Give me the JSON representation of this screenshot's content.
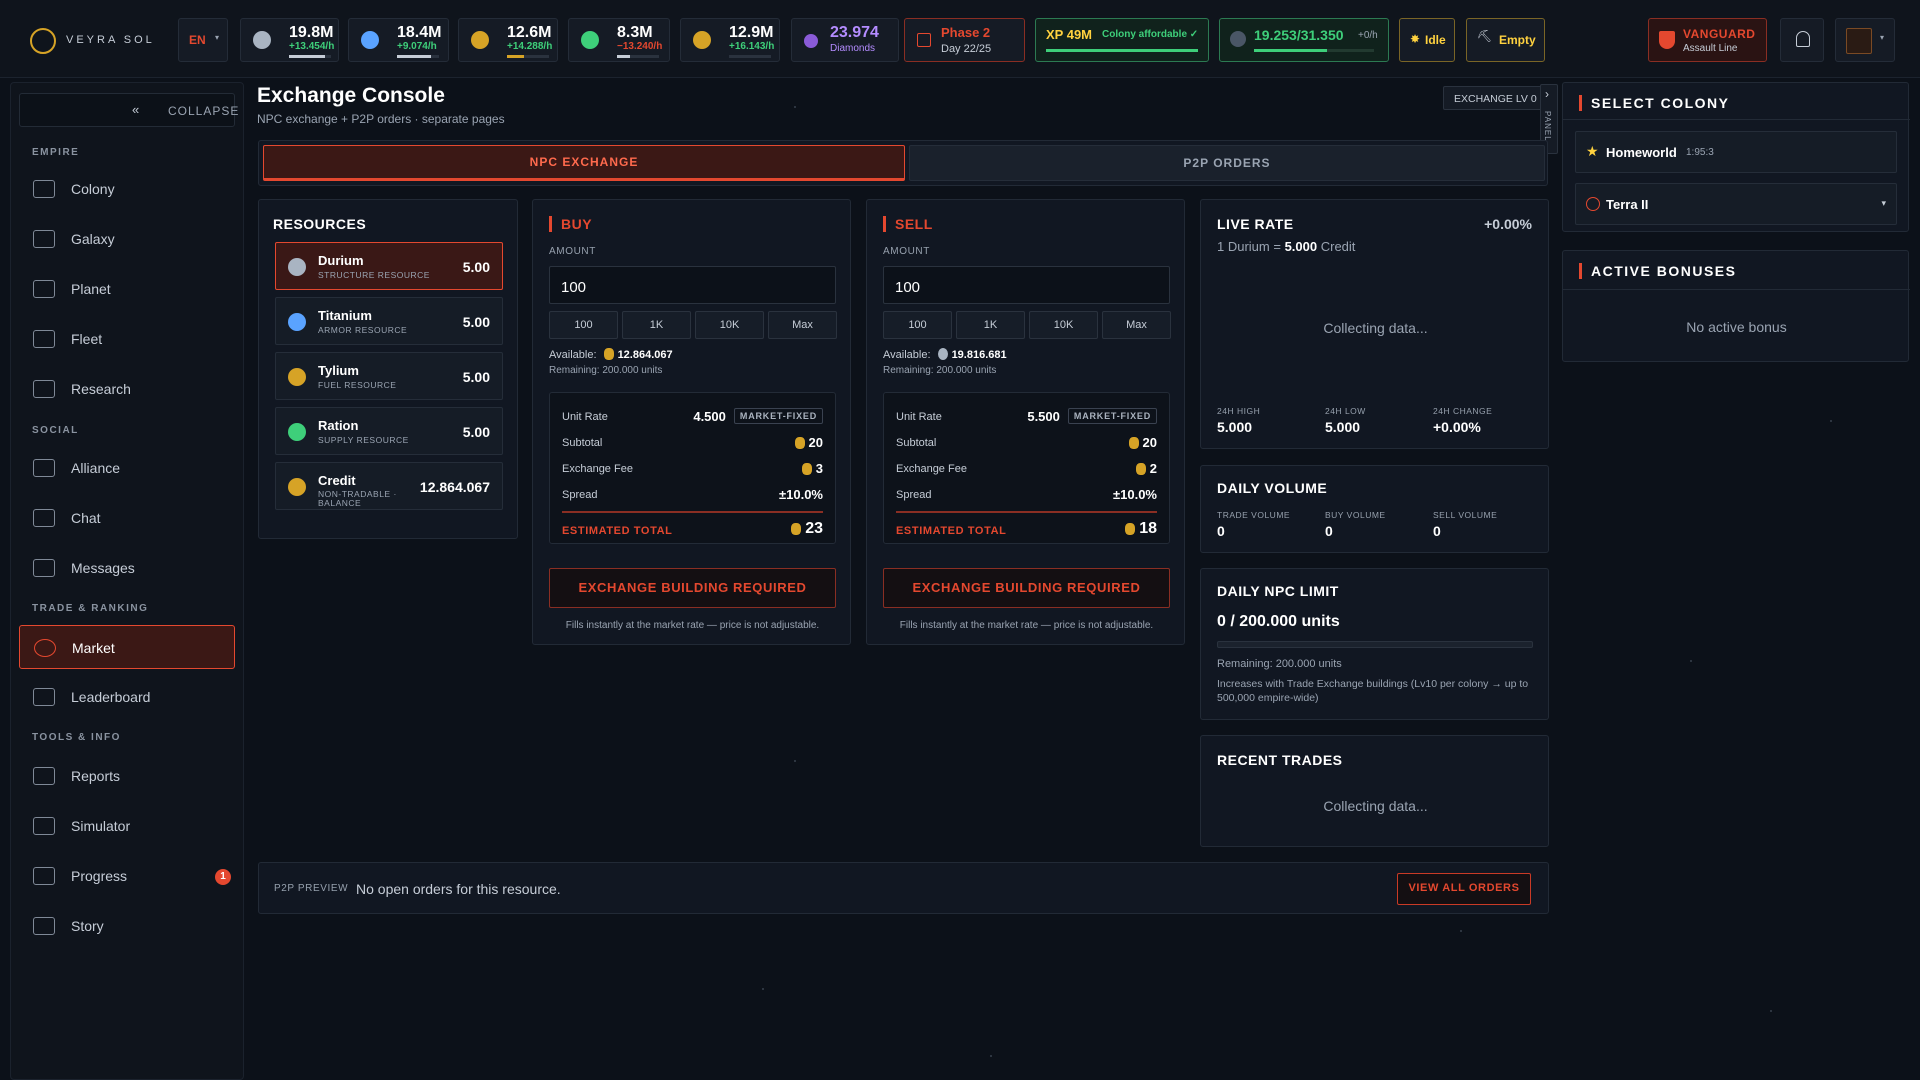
{
  "header": {
    "brand": "VEYRA SOL",
    "language": "EN",
    "resources": [
      {
        "name": "durium-icon",
        "value": "19.8M",
        "rate": "+13.454/h",
        "rate_color": "#3ecf7a",
        "bar_fill": 0.85,
        "icon_color": "#a9b4c2"
      },
      {
        "name": "titanium-icon",
        "value": "18.4M",
        "rate": "+9.074/h",
        "rate_color": "#3ecf7a",
        "bar_fill": 0.8,
        "icon_color": "#5aa3ff"
      },
      {
        "name": "tylium-icon",
        "value": "12.6M",
        "rate": "+14.288/h",
        "rate_color": "#3ecf7a",
        "bar_fill": 0.4,
        "icon_color": "#d6a326"
      },
      {
        "name": "ration-icon",
        "value": "8.3M",
        "rate": "−13.240/h",
        "rate_color": "#e4482f",
        "bar_fill": 0.3,
        "icon_color": "#3ecf7a"
      },
      {
        "name": "credit-icon",
        "value": "12.9M",
        "rate": "+16.143/h",
        "rate_color": "#3ecf7a",
        "bar_fill": 0.0,
        "icon_color": "#d6a326"
      }
    ],
    "diamonds": {
      "value": "23.974",
      "label": "Diamonds"
    },
    "phase": {
      "title": "Phase 2",
      "day": "Day 22/25"
    },
    "xp": {
      "value": "XP 49M",
      "status": "Colony affordable ✓",
      "fill": 1.0
    },
    "population": {
      "value": "19.253/31.350",
      "rate": "+0/h",
      "fill": 0.61
    },
    "idle_label": "Idle",
    "empty_label": "Empty",
    "faction": {
      "name": "VANGUARD",
      "sub": "Assault Line"
    }
  },
  "sidebar": {
    "collapse_label": "COLLAPSE",
    "sections": {
      "empire": "EMPIRE",
      "social": "SOCIAL",
      "trade": "TRADE & RANKING",
      "tools": "TOOLS & INFO"
    },
    "items": [
      "Colony",
      "Galaxy",
      "Planet",
      "Fleet",
      "Research",
      "Alliance",
      "Chat",
      "Messages",
      "Market",
      "Leaderboard",
      "Reports",
      "Simulator",
      "Progress",
      "Story"
    ],
    "progress_badge": "1"
  },
  "main": {
    "title": "Exchange Console",
    "subtitle": "NPC exchange + P2P orders · separate pages",
    "exchange_level": "EXCHANGE LV 0",
    "panel_tab": "PANEL",
    "tabs": [
      "NPC EXCHANGE",
      "P2P ORDERS"
    ],
    "resources_title": "RESOURCES",
    "resources": [
      {
        "name": "Durium",
        "sub": "STRUCTURE RESOURCE",
        "value": "5.00",
        "color": "#a9b4c2"
      },
      {
        "name": "Titanium",
        "sub": "ARMOR RESOURCE",
        "value": "5.00",
        "color": "#5aa3ff"
      },
      {
        "name": "Tylium",
        "sub": "FUEL RESOURCE",
        "value": "5.00",
        "color": "#d6a326"
      },
      {
        "name": "Ration",
        "sub": "SUPPLY RESOURCE",
        "value": "5.00",
        "color": "#3ecf7a"
      },
      {
        "name": "Credit",
        "sub": "NON-TRADABLE · BALANCE",
        "value": "12.864.067",
        "color": "#d6a326"
      }
    ],
    "buy": {
      "title": "BUY",
      "amount_label": "AMOUNT",
      "amount": "100",
      "quick": [
        "100",
        "1K",
        "10K",
        "Max"
      ],
      "available_label": "Available:",
      "available": "12.864.067",
      "remaining": "Remaining: 200.000 units",
      "unit_rate_label": "Unit Rate",
      "unit_rate": "4.500",
      "market_fixed": "MARKET-FIXED",
      "subtotal_label": "Subtotal",
      "subtotal": "20",
      "fee_label": "Exchange Fee",
      "fee": "3",
      "spread_label": "Spread",
      "spread": "±10.0%",
      "total_label": "ESTIMATED TOTAL",
      "total": "23",
      "button": "EXCHANGE BUILDING REQUIRED",
      "note": "Fills instantly at the market rate — price is not adjustable."
    },
    "sell": {
      "title": "SELL",
      "amount_label": "AMOUNT",
      "amount": "100",
      "quick": [
        "100",
        "1K",
        "10K",
        "Max"
      ],
      "available_label": "Available:",
      "available": "19.816.681",
      "remaining": "Remaining: 200.000 units",
      "unit_rate_label": "Unit Rate",
      "unit_rate": "5.500",
      "market_fixed": "MARKET-FIXED",
      "subtotal_label": "Subtotal",
      "subtotal": "20",
      "fee_label": "Exchange Fee",
      "fee": "2",
      "spread_label": "Spread",
      "spread": "±10.0%",
      "total_label": "ESTIMATED TOTAL",
      "total": "18",
      "button": "EXCHANGE BUILDING REQUIRED",
      "note": "Fills instantly at the market rate — price is not adjustable."
    },
    "live_rate": {
      "title": "LIVE RATE",
      "change": "+0.00%",
      "rate_prefix": "1 Durium = ",
      "rate_value": "5.000",
      "rate_suffix": " Credit",
      "collecting": "Collecting data...",
      "stats": [
        {
          "label": "24H HIGH",
          "value": "5.000"
        },
        {
          "label": "24H LOW",
          "value": "5.000"
        },
        {
          "label": "24H CHANGE",
          "value": "+0.00%"
        }
      ]
    },
    "daily_volume": {
      "title": "DAILY VOLUME",
      "stats": [
        {
          "label": "TRADE VOLUME",
          "value": "0"
        },
        {
          "label": "BUY VOLUME",
          "value": "0"
        },
        {
          "label": "SELL VOLUME",
          "value": "0"
        }
      ]
    },
    "daily_limit": {
      "title": "DAILY NPC LIMIT",
      "value": "0 / 200.000 units",
      "fill": 0,
      "remaining": "Remaining: 200.000 units",
      "note": "Increases with Trade Exchange buildings (Lv10 per colony → up to 500,000 empire-wide)"
    },
    "recent_trades": {
      "title": "RECENT TRADES",
      "collecting": "Collecting data..."
    },
    "p2p_preview": {
      "label": "P2P PREVIEW",
      "text": "No open orders for this resource.",
      "button": "VIEW ALL ORDERS"
    }
  },
  "right": {
    "select_colony_title": "SELECT COLONY",
    "homeworld": {
      "name": "Homeworld",
      "coords": "1:95:3"
    },
    "selected_colony": "Terra II",
    "bonuses_title": "ACTIVE BONUSES",
    "bonuses_empty": "No active bonus"
  }
}
